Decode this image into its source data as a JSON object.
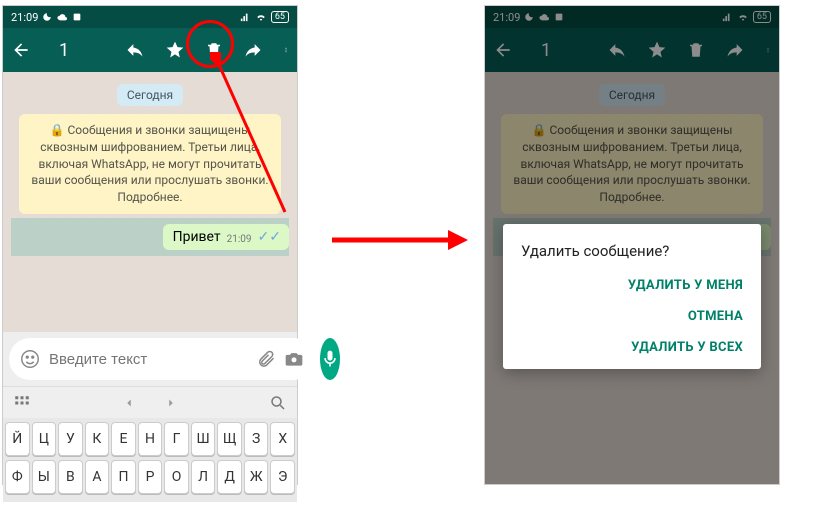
{
  "status": {
    "time": "21:09",
    "battery": "65"
  },
  "toolbar": {
    "selection_count": "1"
  },
  "chat": {
    "date_chip": "Сегодня",
    "encryption_notice": "🔒 Сообщения и звонки защищены сквозным шифрованием. Третьи лица, включая WhatsApp, не могут прочитать ваши сообщения или прослушать звонки. Подробнее.",
    "message_text": "Привет",
    "message_time": "21:09"
  },
  "input": {
    "placeholder": "Введите текст"
  },
  "keyboard": {
    "row1": [
      "Й",
      "Ц",
      "У",
      "К",
      "Е",
      "Н",
      "Г",
      "Ш",
      "Щ",
      "З",
      "Х"
    ],
    "row2": [
      "Ф",
      "Ы",
      "В",
      "А",
      "П",
      "Р",
      "О",
      "Л",
      "Д",
      "Ж",
      "Э"
    ]
  },
  "dialog": {
    "title": "Удалить сообщение?",
    "delete_for_me": "УДАЛИТЬ У МЕНЯ",
    "cancel": "ОТМЕНА",
    "delete_for_all": "УДАЛИТЬ У ВСЕХ"
  }
}
